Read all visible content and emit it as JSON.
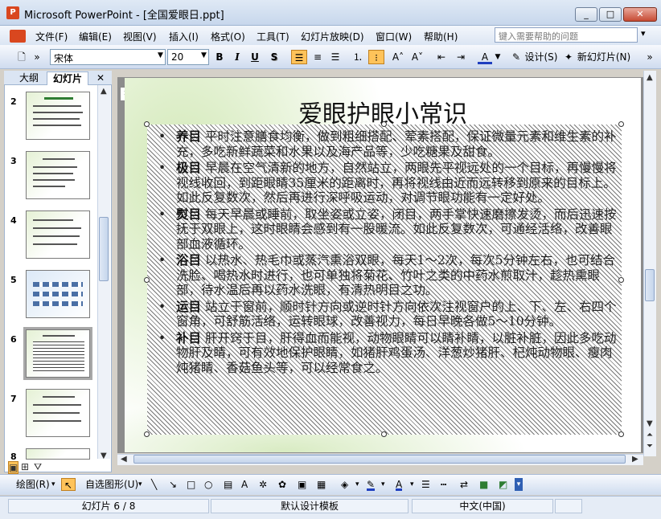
{
  "window": {
    "title": "Microsoft PowerPoint - [全国爱眼日.ppt]",
    "icon": "P",
    "min": "_",
    "max": "□",
    "close": "✕"
  },
  "menu": {
    "items": [
      "文件(F)",
      "编辑(E)",
      "视图(V)",
      "插入(I)",
      "格式(O)",
      "工具(T)",
      "幻灯片放映(D)",
      "窗口(W)",
      "帮助(H)"
    ],
    "help_placeholder": "键入需要帮助的问题"
  },
  "toolbar": {
    "font_name": "宋体",
    "font_size": "20",
    "bold": "B",
    "italic": "I",
    "underline": "U",
    "shadow": "S",
    "design_label": "设计(S)",
    "new_slide_label": "新幻灯片(N)"
  },
  "panel": {
    "tab_outline": "大纲",
    "tab_slides": "幻灯片",
    "close": "✕",
    "slide_numbers": [
      "2",
      "3",
      "4",
      "5",
      "6",
      "7",
      "8"
    ],
    "selected_slide": "6"
  },
  "slide": {
    "title": "爱眼护眼小常识",
    "bullets": [
      {
        "keyword": "养目",
        "text": "平时注意膳食均衡，做到粗细搭配、荤素搭配，保证微量元素和维生素的补充，多吃新鲜蔬菜和水果以及海产品等，少吃糖果及甜食。"
      },
      {
        "keyword": "极目",
        "text": "早晨在空气清新的地方，自然站立，两眼先平视远处的一个目标，再慢慢将视线收回，到距眼睛35厘米的距离时，再将视线由近而远转移到原来的目标上。如此反复数次，然后再进行深呼吸运动，对调节眼功能有一定好处。"
      },
      {
        "keyword": "熨目",
        "text": "每天早晨或睡前，取坐姿或立姿，闭目，两手掌快速磨擦发烫，而后迅速按抚于双眼上，这时眼睛会感到有一股暖流。如此反复数次，可通经活络，改善眼部血液循环。"
      },
      {
        "keyword": "浴目",
        "text": "以热水、热毛巾或蒸汽熏浴双眼，每天1～2次，每次5分钟左右，也可结合洗脸、喝热水时进行，也可单独将菊花、竹叶之类的中药水煎取汁，趁热熏眼部，待水温后再以药水洗眼，有清热明目之功。"
      },
      {
        "keyword": "运目",
        "text": "站立于窗前，顺时针方向或逆时针方向依次注视窗户的上、下、左、右四个窗角，可舒筋活络，运转眼球，改善视力，每日早晚各做5～10分钟。"
      },
      {
        "keyword": "补目",
        "text": "肝开窍于目，肝得血而能视，动物眼睛可以睛补睛，以脏补脏，因此多吃动物肝及睛，可有效地保护眼睛，如猪肝鸡蛋汤、洋葱炒猪肝、杞炖动物眼、瘦肉炖猪睛、香菇鱼头等，可以经常食之。"
      }
    ]
  },
  "drawing": {
    "draw_label": "绘图(R)",
    "autoshape_label": "自选图形(U)"
  },
  "status": {
    "slide_info": "幻灯片 6 / 8",
    "template": "默认设计模板",
    "language": "中文(中国)"
  },
  "colors": {
    "accent": "#ffc35a",
    "title_bar": "#c7d7ec",
    "slide_bg_green": "#d2e8b7"
  }
}
